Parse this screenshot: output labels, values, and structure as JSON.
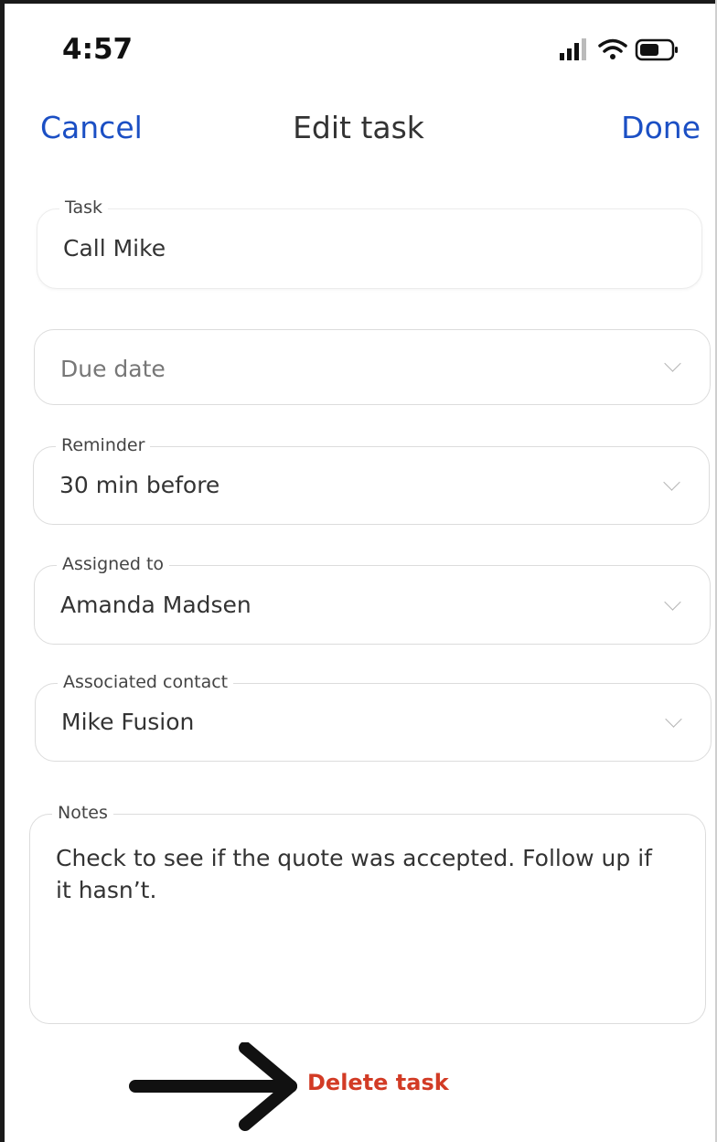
{
  "status_bar": {
    "time": "4:57",
    "icons": [
      "signal-icon",
      "wifi-icon",
      "battery-icon"
    ]
  },
  "nav": {
    "cancel_label": "Cancel",
    "title": "Edit task",
    "done_label": "Done"
  },
  "form": {
    "task": {
      "label": "Task",
      "value": "Call Mike"
    },
    "due_date": {
      "placeholder": "Due date"
    },
    "reminder": {
      "label": "Reminder",
      "value": "30 min before"
    },
    "assigned_to": {
      "label": "Assigned to",
      "value": "Amanda Madsen"
    },
    "associated_contact": {
      "label": "Associated contact",
      "value": "Mike Fusion"
    },
    "notes": {
      "label": "Notes",
      "value": "Check to see if the quote was accepted. Follow up if it hasn’t."
    }
  },
  "actions": {
    "delete_label": "Delete task"
  },
  "colors": {
    "accent": "#1b4fc4",
    "danger": "#d23b25",
    "border": "#dcdcdc"
  }
}
